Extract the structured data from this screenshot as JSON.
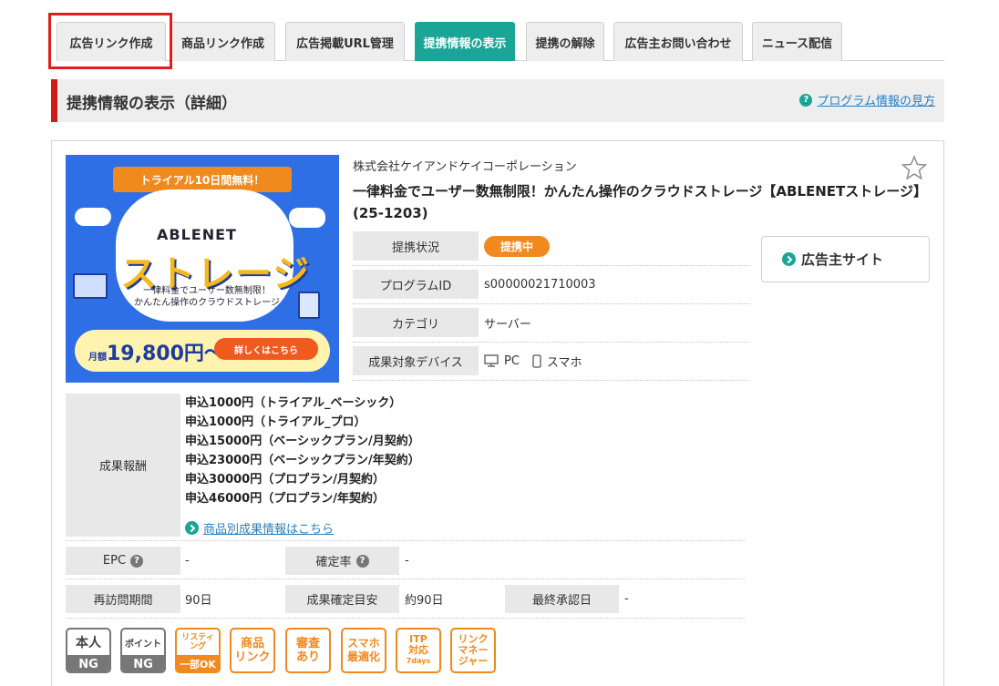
{
  "tabs": [
    {
      "label": "広告リンク作成",
      "active": false
    },
    {
      "label": "商品リンク作成",
      "active": false
    },
    {
      "label": "広告掲載URL管理",
      "active": false
    },
    {
      "label": "提携情報の表示",
      "active": true
    },
    {
      "label": "提携の解除",
      "active": false
    },
    {
      "label": "広告主お問い合わせ",
      "active": false
    },
    {
      "label": "ニュース配信",
      "active": false
    }
  ],
  "section": {
    "title": "提携情報の表示（詳細）",
    "help_link": "プログラム情報の見方"
  },
  "banner": {
    "ribbon": "トライアル10日間無料！",
    "brand": "ABLENET",
    "big": "ストレージ",
    "sub_line1": "一律料金でユーザー数無制限！",
    "sub_line2": "かんたん操作のクラウドストレージ",
    "price_prefix": "月額",
    "price": "19,800円～",
    "cta": "詳しくはこちら"
  },
  "program": {
    "company": "株式会社ケイアンドケイコーポレーション",
    "title": "一律料金でユーザー数無制限！かんたん操作のクラウドストレージ【ABLENETストレージ】(25-1203)"
  },
  "info": {
    "status_label": "提携状況",
    "status_value": "提携中",
    "program_id_label": "プログラムID",
    "program_id_value": "s00000021710003",
    "category_label": "カテゴリ",
    "category_value": "サーバー",
    "device_label": "成果対象デバイス",
    "device_pc": "PC",
    "device_sp": "スマホ"
  },
  "advertiser_site": "広告主サイト",
  "reward": {
    "label": "成果報酬",
    "items": [
      "申込1000円（トライアル_ベーシック）",
      "申込1000円（トライアル_プロ）",
      "申込15000円（ベーシックプラン/月契約）",
      "申込23000円（ベーシックプラン/年契約）",
      "申込30000円（プロプラン/月契約）",
      "申込46000円（プロプラン/年契約）"
    ],
    "link": "商品別成果情報はこちら"
  },
  "metrics": {
    "epc_label": "EPC",
    "epc_value": "-",
    "rate_label": "確定率",
    "rate_value": "-",
    "revisit_label": "再訪問期間",
    "revisit_value": "90日",
    "confirm_label": "成果確定目安",
    "confirm_value": "約90日",
    "last_approval_label": "最終承認日",
    "last_approval_value": "-"
  },
  "features": {
    "self_top": "本人",
    "self_bot": "NG",
    "point_top": "ポイント",
    "point_bot": "NG",
    "listing_top1": "リスティ",
    "listing_top2": "ング",
    "listing_bot": "一部OK",
    "product_1": "商品",
    "product_2": "リンク",
    "review_1": "審査",
    "review_2": "あり",
    "sp_1": "スマホ",
    "sp_2": "最適化",
    "itp_1": "ITP",
    "itp_2": "対応",
    "itp_3": "7days",
    "lm_1": "リンク",
    "lm_2": "マネー",
    "lm_3": "ジャー"
  },
  "colors": {
    "accent": "#1aa596",
    "highlight": "#e01e1e",
    "section_bar": "#cc1b1b",
    "badge_orange": "#f08a1e",
    "link": "#2a7fbf"
  }
}
